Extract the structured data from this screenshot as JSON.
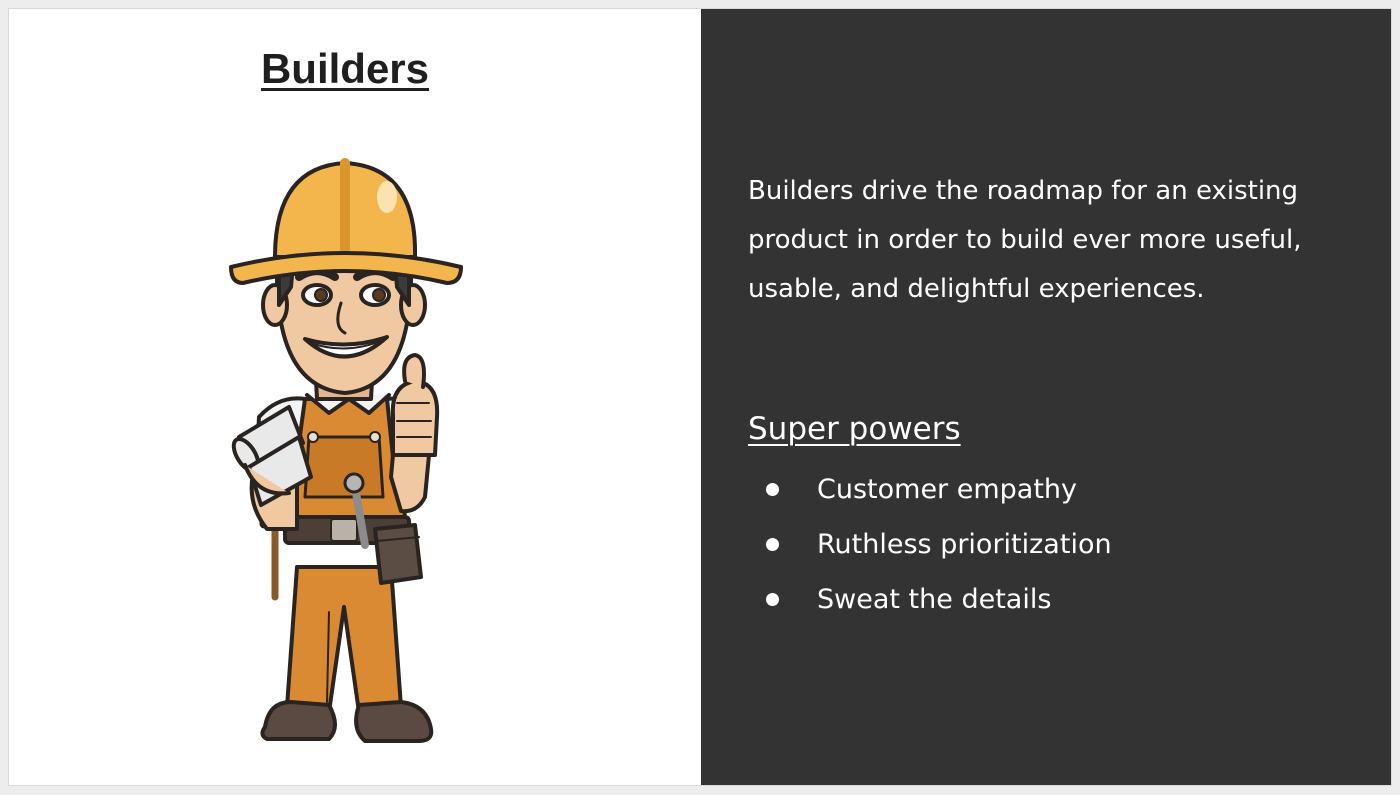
{
  "title": "Builders",
  "description": "Builders drive the roadmap for an existing product in order to build ever more useful, usable, and delightful experiences.",
  "super_powers": {
    "heading": "Super powers",
    "items": [
      {
        "label": "Customer empathy"
      },
      {
        "label": "Ruthless prioritization"
      },
      {
        "label": "Sweat the details"
      }
    ]
  },
  "illustration": {
    "subject": "cartoon construction worker with hard hat giving thumbs up",
    "icon": "builder-illustration"
  },
  "colors": {
    "left_panel": "#ffffff",
    "right_panel": "#333333",
    "title_text": "#1f1f1f",
    "panel_text": "#ffffff",
    "hard_hat": "#f2b64d",
    "overalls": "#d98a32"
  }
}
